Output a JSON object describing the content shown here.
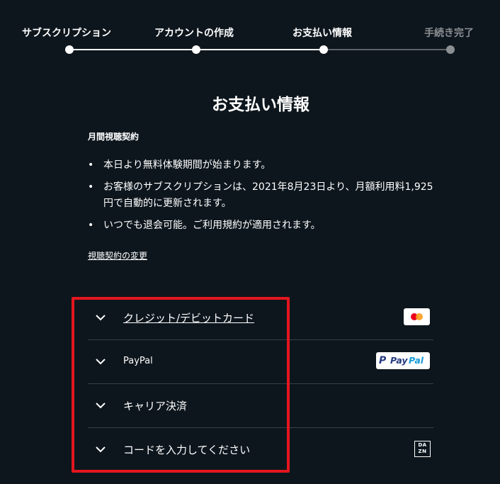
{
  "steps": [
    {
      "label": "サブスクリプション",
      "state": "done"
    },
    {
      "label": "アカウントの作成",
      "state": "done"
    },
    {
      "label": "お支払い情報",
      "state": "current"
    },
    {
      "label": "手続き完了",
      "state": "pending"
    }
  ],
  "page": {
    "title": "お支払い情報",
    "plan_label": "月間視聴契約",
    "bullets": [
      "本日より無料体験期間が始まります。",
      "お客様のサブスクリプションは、2021年8月23日より、月額利用料1,925円で自動的に更新されます。",
      "いつでも退会可能。ご利用規約が適用されます。"
    ],
    "change_plan_link": "視聴契約の変更"
  },
  "payment_methods": [
    {
      "label": "クレジット/デビットカード",
      "icon": "mastercard-logo"
    },
    {
      "label": "PayPal",
      "icon": "paypal-logo",
      "logo_text": "PayPal"
    },
    {
      "label": "キャリア決済",
      "icon": ""
    },
    {
      "label": "コードを入力してください",
      "icon": "dazn-logo",
      "logo_text": "DAZN"
    }
  ],
  "colors": {
    "background": "#0d161d",
    "text": "#ffffff",
    "inactive": "#8b8f93",
    "highlight": "#e4161e",
    "divider": "#3a4046"
  }
}
